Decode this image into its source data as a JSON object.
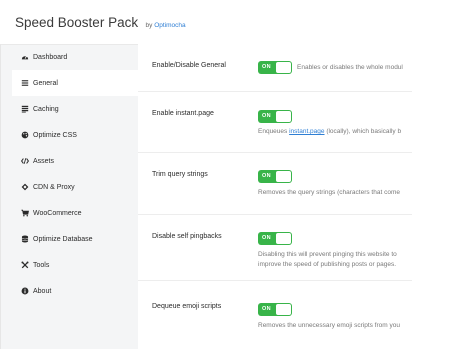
{
  "header": {
    "title": "Speed Booster Pack",
    "by": "by",
    "author": "Optimocha"
  },
  "sidebar": {
    "items": [
      {
        "label": "Dashboard",
        "icon": "dashboard-icon",
        "active": false
      },
      {
        "label": "General",
        "icon": "list-icon",
        "active": true
      },
      {
        "label": "Caching",
        "icon": "caching-icon",
        "active": false
      },
      {
        "label": "Optimize CSS",
        "icon": "palette-icon",
        "active": false
      },
      {
        "label": "Assets",
        "icon": "code-icon",
        "active": false
      },
      {
        "label": "CDN & Proxy",
        "icon": "cdn-icon",
        "active": false
      },
      {
        "label": "WooCommerce",
        "icon": "cart-icon",
        "active": false
      },
      {
        "label": "Optimize Database",
        "icon": "database-icon",
        "active": false
      },
      {
        "label": "Tools",
        "icon": "tools-icon",
        "active": false
      },
      {
        "label": "About",
        "icon": "info-icon",
        "active": false
      }
    ]
  },
  "settings": [
    {
      "label": "Enable/Disable General",
      "toggle": "ON",
      "description": "Enables or disables the whole modul"
    },
    {
      "label": "Enable instant.page",
      "toggle": "ON",
      "description_prefix": "Enqueues ",
      "description_link": "instant.page",
      "description_suffix": " (locally), which basically b"
    },
    {
      "label": "Trim query strings",
      "toggle": "ON",
      "description": "Removes the query strings (characters that come"
    },
    {
      "label": "Disable self pingbacks",
      "toggle": "ON",
      "description_line1": "Disabling this will prevent pinging this website to",
      "description_line2": "improve the speed of publishing posts or pages."
    },
    {
      "label": "Dequeue emoji scripts",
      "toggle": "ON",
      "description": "Removes the unnecessary emoji scripts from you"
    }
  ],
  "colors": {
    "toggle_on": "#38b449",
    "link": "#2f7fd4",
    "sidebar_bg": "#f4f5f6"
  }
}
